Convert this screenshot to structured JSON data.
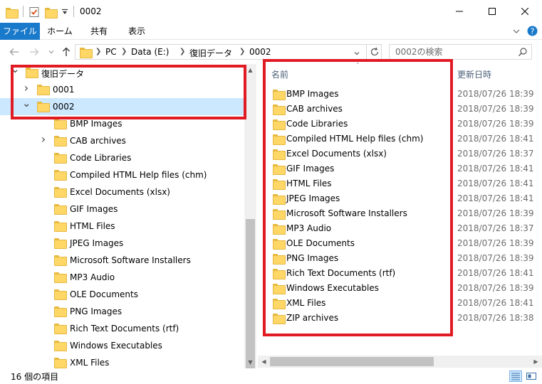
{
  "window": {
    "title": "0002",
    "controls": [
      "minimize",
      "maximize",
      "close"
    ]
  },
  "ribbon": {
    "tabs": [
      "ファイル",
      "ホーム",
      "共有",
      "表示"
    ]
  },
  "address": {
    "path": [
      "PC",
      "Data (E:)",
      "復旧データ",
      "0002"
    ],
    "search_placeholder": "0002の検索"
  },
  "nav_tree": [
    {
      "label": "復旧データ",
      "level": 0,
      "expanded": true
    },
    {
      "label": "0001",
      "level": 1,
      "expanded": false,
      "has_children": true
    },
    {
      "label": "0002",
      "level": 1,
      "expanded": true,
      "selected": true
    },
    {
      "label": "BMP Images",
      "level": 2
    },
    {
      "label": "CAB archives",
      "level": 2,
      "has_children": true
    },
    {
      "label": "Code Libraries",
      "level": 2
    },
    {
      "label": "Compiled HTML Help files (chm)",
      "level": 2
    },
    {
      "label": "Excel Documents (xlsx)",
      "level": 2
    },
    {
      "label": "GIF Images",
      "level": 2
    },
    {
      "label": "HTML Files",
      "level": 2
    },
    {
      "label": "JPEG Images",
      "level": 2
    },
    {
      "label": "Microsoft Software Installers",
      "level": 2
    },
    {
      "label": "MP3 Audio",
      "level": 2
    },
    {
      "label": "OLE Documents",
      "level": 2
    },
    {
      "label": "PNG Images",
      "level": 2
    },
    {
      "label": "Rich Text Documents (rtf)",
      "level": 2
    },
    {
      "label": "Windows Executables",
      "level": 2
    },
    {
      "label": "XML Files",
      "level": 2
    }
  ],
  "columns": {
    "name": "名前",
    "date": "更新日時"
  },
  "files": [
    {
      "name": "BMP Images",
      "date": "2018/07/26 18:39"
    },
    {
      "name": "CAB archives",
      "date": "2018/07/26 18:39"
    },
    {
      "name": "Code Libraries",
      "date": "2018/07/26 18:39"
    },
    {
      "name": "Compiled HTML Help files (chm)",
      "date": "2018/07/26 18:41"
    },
    {
      "name": "Excel Documents (xlsx)",
      "date": "2018/07/26 18:37"
    },
    {
      "name": "GIF Images",
      "date": "2018/07/26 18:41"
    },
    {
      "name": "HTML Files",
      "date": "2018/07/26 18:41"
    },
    {
      "name": "JPEG Images",
      "date": "2018/07/26 18:41"
    },
    {
      "name": "Microsoft Software Installers",
      "date": "2018/07/26 18:39"
    },
    {
      "name": "MP3 Audio",
      "date": "2018/07/26 18:37"
    },
    {
      "name": "OLE Documents",
      "date": "2018/07/26 18:39"
    },
    {
      "name": "PNG Images",
      "date": "2018/07/26 18:39"
    },
    {
      "name": "Rich Text Documents (rtf)",
      "date": "2018/07/26 18:41"
    },
    {
      "name": "Windows Executables",
      "date": "2018/07/26 18:39"
    },
    {
      "name": "XML Files",
      "date": "2018/07/26 18:41"
    },
    {
      "name": "ZIP archives",
      "date": "2018/07/26 18:38"
    }
  ],
  "status": {
    "item_count": "16 個の項目"
  },
  "colors": {
    "accent": "#1979ca",
    "selection": "#cce8ff",
    "highlight_box": "#e01b24"
  }
}
